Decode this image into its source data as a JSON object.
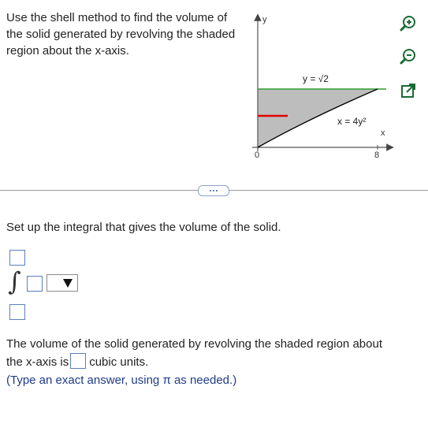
{
  "problem": {
    "text": "Use the shell method to find the volume of the solid generated by revolving the shaded region about the x-axis."
  },
  "graph": {
    "y_axis_label": "y",
    "x_axis_label": "x",
    "origin_label": "0",
    "x_tick_label": "8",
    "line_label": "y = √2",
    "curve_label": "x = 4y²",
    "colors": {
      "shade": "#bdbdbd",
      "horizontal_line": "#2e9e2e",
      "shell_segment": "#e00000",
      "curve": "#000000"
    }
  },
  "tools": {
    "zoom_in": "zoom-in-icon",
    "zoom_out": "zoom-out-icon",
    "popout": "popout-icon"
  },
  "instruction": "Set up the integral that gives the volume of the solid.",
  "integral": {
    "sign": "∫",
    "upper_limit_value": "",
    "lower_limit_value": "",
    "integrand_value": "",
    "differential_selected": ""
  },
  "result": {
    "line1": "The volume of the solid generated by revolving the shaded region about",
    "line2_prefix": "the x-axis is",
    "line2_suffix": "cubic units.",
    "hint": "(Type an exact answer, using π as needed.)"
  }
}
